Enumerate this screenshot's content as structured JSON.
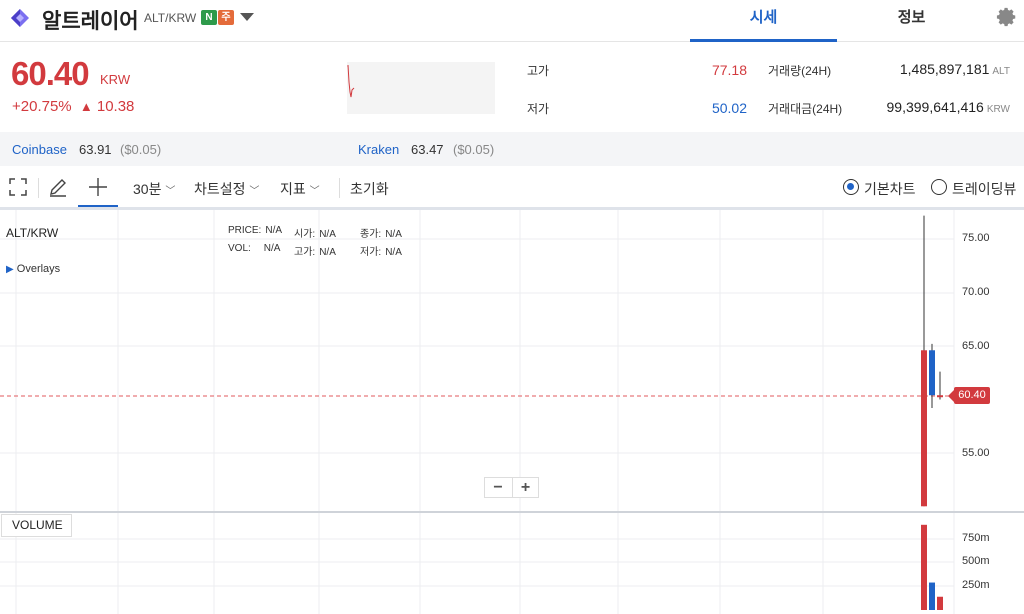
{
  "header": {
    "coin_name": "알트레이어",
    "pair": "ALT/KRW",
    "badge_n": "N",
    "badge_ju": "주",
    "tabs": [
      {
        "label": "시세",
        "active": true
      },
      {
        "label": "정보",
        "active": false
      }
    ]
  },
  "summary": {
    "price": "60.40",
    "unit": "KRW",
    "change_rate": "+20.75%",
    "change_arrow": "▲",
    "change_amount": "10.38",
    "high_label": "고가",
    "high": "77.18",
    "low_label": "저가",
    "low": "50.02",
    "volume_label": "거래량(24H)",
    "volume": "1,485,897,181",
    "volume_unit": "ALT",
    "value_label": "거래대금(24H)",
    "value": "99,399,641,416",
    "value_unit": "KRW"
  },
  "exchanges": [
    {
      "name": "Coinbase",
      "price": "63.91",
      "diff": "($0.05)"
    },
    {
      "name": "Kraken",
      "price": "63.47",
      "diff": "($0.05)"
    }
  ],
  "toolbar": {
    "interval": "30분",
    "chart_settings": "차트설정",
    "indicators": "지표",
    "reset": "초기화",
    "basic_chart": "기본차트",
    "trading_view": "트레이딩뷰"
  },
  "chart": {
    "pair": "ALT/KRW",
    "overlays": "Overlays",
    "info": {
      "price_label": "PRICE:",
      "price": "N/A",
      "open_label": "시가:",
      "open": "N/A",
      "close_label": "종가:",
      "close": "N/A",
      "vol_label": "VOL:",
      "vol": "N/A",
      "high_label": "고가:",
      "high": "N/A",
      "low_label": "저가:",
      "low": "N/A"
    },
    "y_ticks": [
      "75.00",
      "70.00",
      "65.00",
      "55.00"
    ],
    "current_price_tag": "60.40",
    "volume_label": "VOLUME",
    "volume_ticks": [
      "750m",
      "500m",
      "250m"
    ],
    "zoom_out": "−",
    "zoom_in": "+"
  },
  "colors": {
    "up": "#d23a3e",
    "down": "#1f63c7",
    "accent": "#1f63c7"
  },
  "chart_data": {
    "type": "candlestick",
    "y_range": [
      50,
      77.18
    ],
    "candles": [
      {
        "open": 50.02,
        "high": 77.18,
        "low": 50.02,
        "close": 64.6,
        "volume": 900
      },
      {
        "open": 64.6,
        "high": 65.2,
        "low": 59.2,
        "close": 60.4,
        "volume": 290
      },
      {
        "open": 60.4,
        "high": 62.6,
        "low": 60.0,
        "close": 60.4,
        "volume": 140
      }
    ]
  }
}
